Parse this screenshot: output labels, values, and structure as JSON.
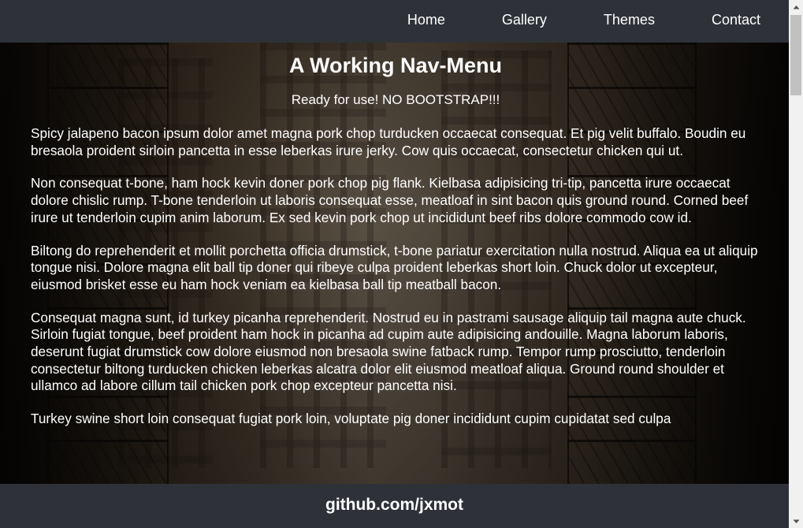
{
  "nav": {
    "items": [
      {
        "label": "Home"
      },
      {
        "label": "Gallery"
      },
      {
        "label": "Themes"
      },
      {
        "label": "Contact"
      }
    ]
  },
  "main": {
    "title": "A Working Nav-Menu",
    "subtitle": "Ready for use! NO BOOTSTRAP!!!",
    "paragraphs": [
      "Spicy jalapeno bacon ipsum dolor amet magna pork chop turducken occaecat consequat. Et pig velit buffalo. Boudin eu bresaola proident sirloin pancetta in esse leberkas irure jerky. Cow quis occaecat, consectetur chicken qui ut.",
      "Non consequat t-bone, ham hock kevin doner pork chop pig flank. Kielbasa adipisicing tri-tip, pancetta irure occaecat dolore chislic rump. T-bone tenderloin ut laboris consequat esse, meatloaf in sint bacon quis ground round. Corned beef irure ut tenderloin cupim anim laborum. Ex sed kevin pork chop ut incididunt beef ribs dolore commodo cow id.",
      "Biltong do reprehenderit et mollit porchetta officia drumstick, t-bone pariatur exercitation nulla nostrud. Aliqua ea ut aliquip tongue nisi. Dolore magna elit ball tip doner qui ribeye culpa proident leberkas short loin. Chuck dolor ut excepteur, eiusmod brisket esse eu ham hock veniam ea kielbasa ball tip meatball bacon.",
      "Consequat magna sunt, id turkey picanha reprehenderit. Nostrud eu in pastrami sausage aliquip tail magna aute chuck. Sirloin fugiat tongue, beef proident ham hock in picanha ad cupim aute adipisicing andouille. Magna laborum laboris, deserunt fugiat drumstick cow dolore eiusmod non bresaola swine fatback rump. Tempor rump prosciutto, tenderloin consectetur biltong turducken chicken leberkas alcatra dolor elit eiusmod meatloaf aliqua. Ground round shoulder et ullamco ad labore cillum tail chicken pork chop excepteur pancetta nisi.",
      "Turkey swine short loin consequat fugiat pork loin, voluptate pig doner incididunt cupim cupidatat sed culpa"
    ]
  },
  "footer": {
    "link_text": "github.com/jxmot"
  },
  "scrollbar": {
    "up_icon": "chevron-up-icon",
    "down_icon": "chevron-down-icon"
  }
}
